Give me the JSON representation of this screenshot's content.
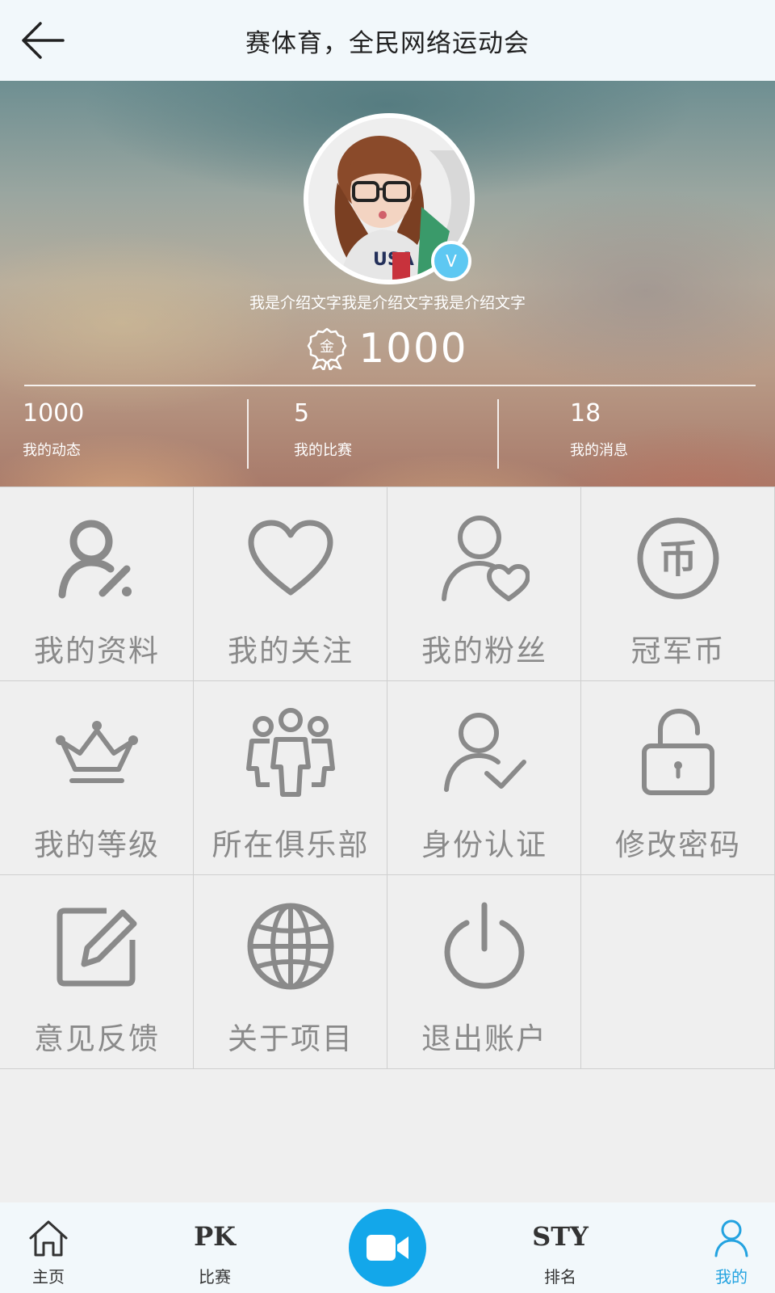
{
  "header": {
    "title": "赛体育，全民网络运动会"
  },
  "profile": {
    "intro": "我是介绍文字我是介绍文字我是介绍文字",
    "verified_badge": "V",
    "coins": "1000",
    "coin_icon_glyph": "金"
  },
  "stats": [
    {
      "value": "1000",
      "label": "我的动态"
    },
    {
      "value": "5",
      "label": "我的比赛"
    },
    {
      "value": "18",
      "label": "我的消息"
    }
  ],
  "grid": [
    {
      "label": "我的资料",
      "icon": "user-edit-icon"
    },
    {
      "label": "我的关注",
      "icon": "heart-icon"
    },
    {
      "label": "我的粉丝",
      "icon": "user-heart-icon"
    },
    {
      "label": "冠军币",
      "icon": "coin-icon",
      "glyph": "币"
    },
    {
      "label": "我的等级",
      "icon": "crown-icon"
    },
    {
      "label": "所在俱乐部",
      "icon": "group-icon"
    },
    {
      "label": "身份认证",
      "icon": "user-check-icon"
    },
    {
      "label": "修改密码",
      "icon": "unlock-icon"
    },
    {
      "label": "意见反馈",
      "icon": "edit-icon"
    },
    {
      "label": "关于项目",
      "icon": "globe-icon"
    },
    {
      "label": "退出账户",
      "icon": "power-icon"
    }
  ],
  "bottom_nav": [
    {
      "label": "主页",
      "icon": "home-icon"
    },
    {
      "label": "比赛",
      "icon_text": "PK"
    },
    {
      "label": "",
      "icon": "video-camera-icon"
    },
    {
      "label": "排名",
      "icon_text": "STY"
    },
    {
      "label": "我的",
      "icon": "user-icon",
      "active": true
    }
  ],
  "colors": {
    "header_bg": "#f2f8fb",
    "grid_bg": "#efefef",
    "icon_gray": "#8a8a8a",
    "accent_blue": "#13a7ea",
    "active_blue": "#24a3e0",
    "badge_blue": "#5ec8f2"
  }
}
